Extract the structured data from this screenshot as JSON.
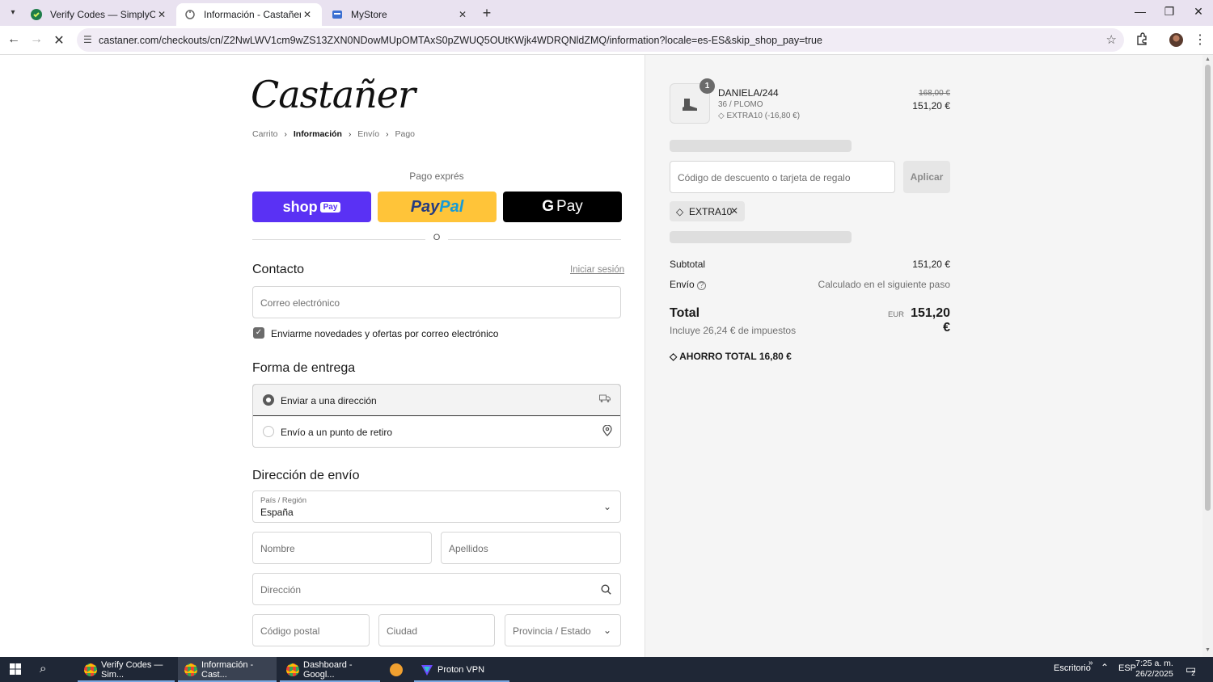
{
  "browser": {
    "tabs": [
      {
        "title": "Verify Codes — SimplyCodes",
        "close": "✕"
      },
      {
        "title": "Información - Castañer - Pantalla de pago",
        "close": "✕"
      },
      {
        "title": "MyStore",
        "close": "✕"
      }
    ],
    "new_tab": "+",
    "url": "castaner.com/checkouts/cn/Z2NwLWV1cm9wZS13ZXN0NDowMUpOMTAxS0pZWUQ5OUtKWjk4WDRQNldZMQ/information?locale=es-ES&skip_shop_pay=true",
    "window_buttons": [
      "—",
      "❐",
      "✕"
    ]
  },
  "checkout": {
    "logo": "Castañer",
    "breadcrumb": [
      "Carrito",
      "Información",
      "Envío",
      "Pago"
    ],
    "express_title": "Pago exprés",
    "shop_pay": {
      "text": "shop",
      "badge": "Pay"
    },
    "paypal": {
      "pay": "Pay",
      "pal": "Pal"
    },
    "gpay": {
      "g": "G",
      "text": "Pay"
    },
    "or": "O",
    "contact": {
      "heading": "Contacto",
      "login": "Iniciar sesión",
      "email_placeholder": "Correo electrónico",
      "newsletter": "Enviarme novedades y ofertas por correo electrónico",
      "newsletter_checked": true
    },
    "delivery": {
      "heading": "Forma de entrega",
      "options": [
        {
          "label": "Enviar a una dirección",
          "selected": true,
          "icon": "truck-icon"
        },
        {
          "label": "Envío a un punto de retiro",
          "selected": false,
          "icon": "location-pin-icon"
        }
      ]
    },
    "shipping": {
      "heading": "Dirección de envío",
      "country_label": "País / Región",
      "country_value": "España",
      "first_name": "Nombre",
      "last_name": "Apellidos",
      "address": "Dirección",
      "postal_code": "Código postal",
      "city": "Ciudad",
      "province": "Provincia / Estado"
    }
  },
  "summary": {
    "item": {
      "quantity": "1",
      "name": "DANIELA/244",
      "variant": "36 / PLOMO",
      "discount": "EXTRA10 (-16,80 €)",
      "price_old": "168,00 €",
      "price_new": "151,20 €"
    },
    "discount_placeholder": "Código de descuento o tarjeta de regalo",
    "apply": "Aplicar",
    "applied_code": "EXTRA10",
    "subtotal_label": "Subtotal",
    "subtotal_value": "151,20 €",
    "shipping_label": "Envío",
    "shipping_value": "Calculado en el siguiente paso",
    "total_label": "Total",
    "currency": "EUR",
    "total_value": "151,20 €",
    "taxes": "Incluye 26,24 € de impuestos",
    "savings_label": "AHORRO TOTAL",
    "savings_value": "16,80 €"
  },
  "taskbar": {
    "apps": [
      {
        "label": "Verify Codes — Sim..."
      },
      {
        "label": "Información - Cast..."
      },
      {
        "label": "Dashboard - Googl..."
      },
      {
        "label": ""
      },
      {
        "label": "Proton VPN"
      }
    ],
    "desktop": "Escritorio",
    "language": "ESP",
    "time": "7:25 a. m.",
    "date": "26/2/2025",
    "notifications": "2"
  },
  "colors": {
    "shop_pay": "#5a31f4",
    "paypal": "#ffc439",
    "gpay": "#000000",
    "summary_bg": "#f5f5f5",
    "taskbar": "#1f2736"
  }
}
